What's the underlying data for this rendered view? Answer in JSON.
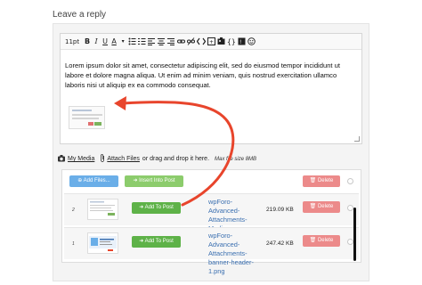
{
  "page": {
    "heading": "Leave a reply"
  },
  "toolbar": {
    "font_size": "11pt",
    "bold": "B",
    "italic": "I",
    "underline": "U",
    "text_color": "A",
    "text_color_caret": "▾",
    "icons": [
      "bullet-list-icon",
      "numbered-list-icon",
      "align-left-icon",
      "align-center-icon",
      "align-right-icon",
      "link-icon",
      "unlink-icon",
      "code-icon",
      "source-code-icon",
      "image-icon",
      "shortcode-icon",
      "insert-icon",
      "spoiler-icon",
      "emoji-icon"
    ]
  },
  "editor": {
    "content": "Lorem ipsum dolor sit amet, consectetur adipiscing elit, sed do eiusmod tempor incididunt ut labore et dolore magna aliqua. Ut enim ad minim veniam, quis nostrud exercitation ullamco laboris nisi ut aliquip ex ea commodo consequat."
  },
  "attach": {
    "my_media": "My Media",
    "attach_files": "Attach Files",
    "drag_text": "or drag and drop it here.",
    "max_size": "Max file size 8MB"
  },
  "files": {
    "add_files": "Add Files...",
    "insert_into_post": "Insert Into Post",
    "delete": "Delete",
    "rows": [
      {
        "num": "2",
        "add_label": "Add To Post",
        "name": "wpForo-Advanced-Attachments-Media-Library.png",
        "size": "219.09 KB",
        "delete": "Delete"
      },
      {
        "num": "1",
        "add_label": "Add To Post",
        "name": "wpForo-Advanced-Attachments-banner-header-1.png",
        "size": "247.42 KB",
        "delete": "Delete"
      }
    ]
  },
  "colors": {
    "arrow": "#e8452c",
    "link": "#3a6fb0",
    "green": "#8ccc6c",
    "blue": "#6aaee8",
    "red": "#ec8a8a"
  }
}
